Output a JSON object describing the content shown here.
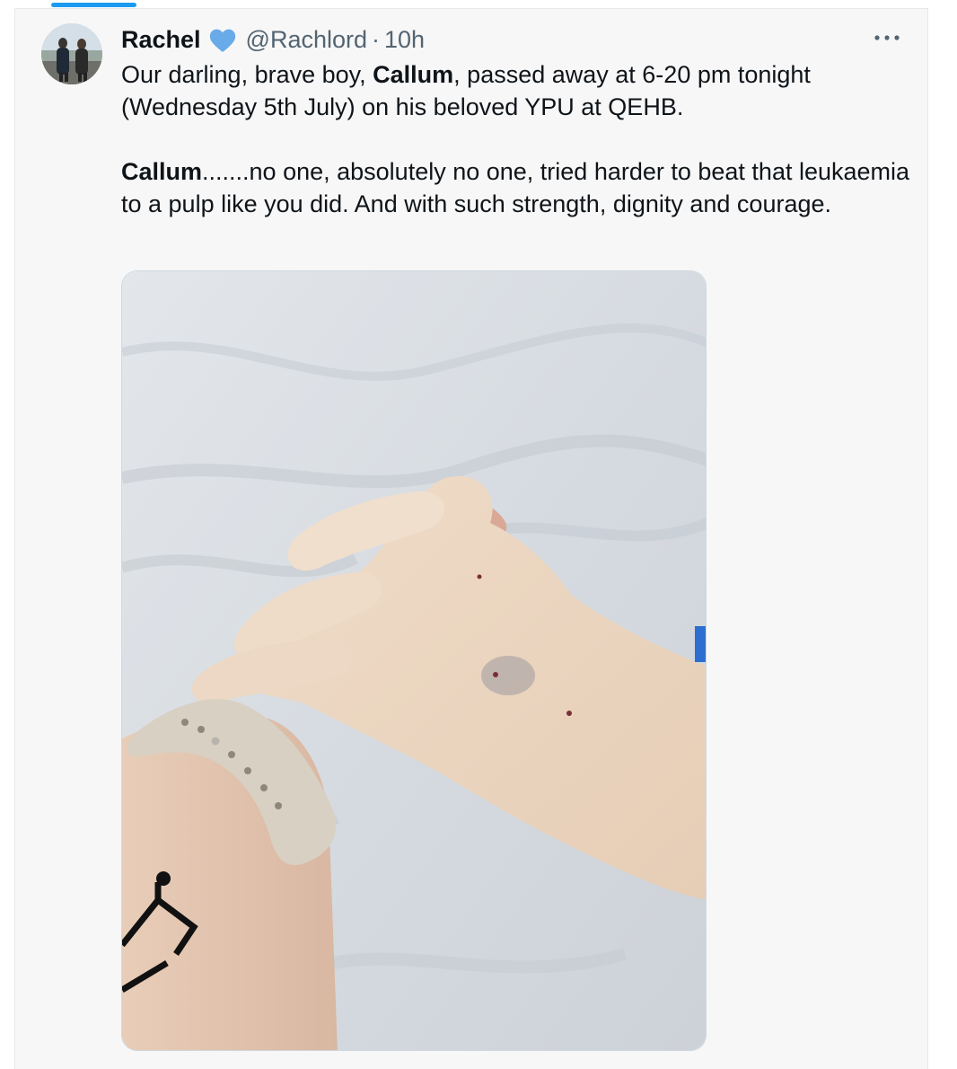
{
  "tweet": {
    "author": {
      "display_name": "Rachel",
      "handle": "@Rachlord",
      "separator": "·",
      "time": "10h"
    },
    "text": {
      "line1_pre": "Our darling, brave boy, ",
      "line1_bold": "Callum",
      "line1_post": ", passed away at 6-20 pm tonight (Wednesday 5th July) on his beloved YPU at QEHB.",
      "line2_bold": "Callum",
      "line2_post": ".......no one, absolutely no one,  tried harder to beat that leukaemia to a pulp like you did. And with such strength, dignity and courage."
    }
  },
  "colors": {
    "accent": "#1d9bf0",
    "text": "#0f1419",
    "secondary_text": "#536471",
    "background": "#f7f7f7"
  },
  "icons": {
    "verified": "verified-badge-icon",
    "more": "more-options-icon"
  }
}
